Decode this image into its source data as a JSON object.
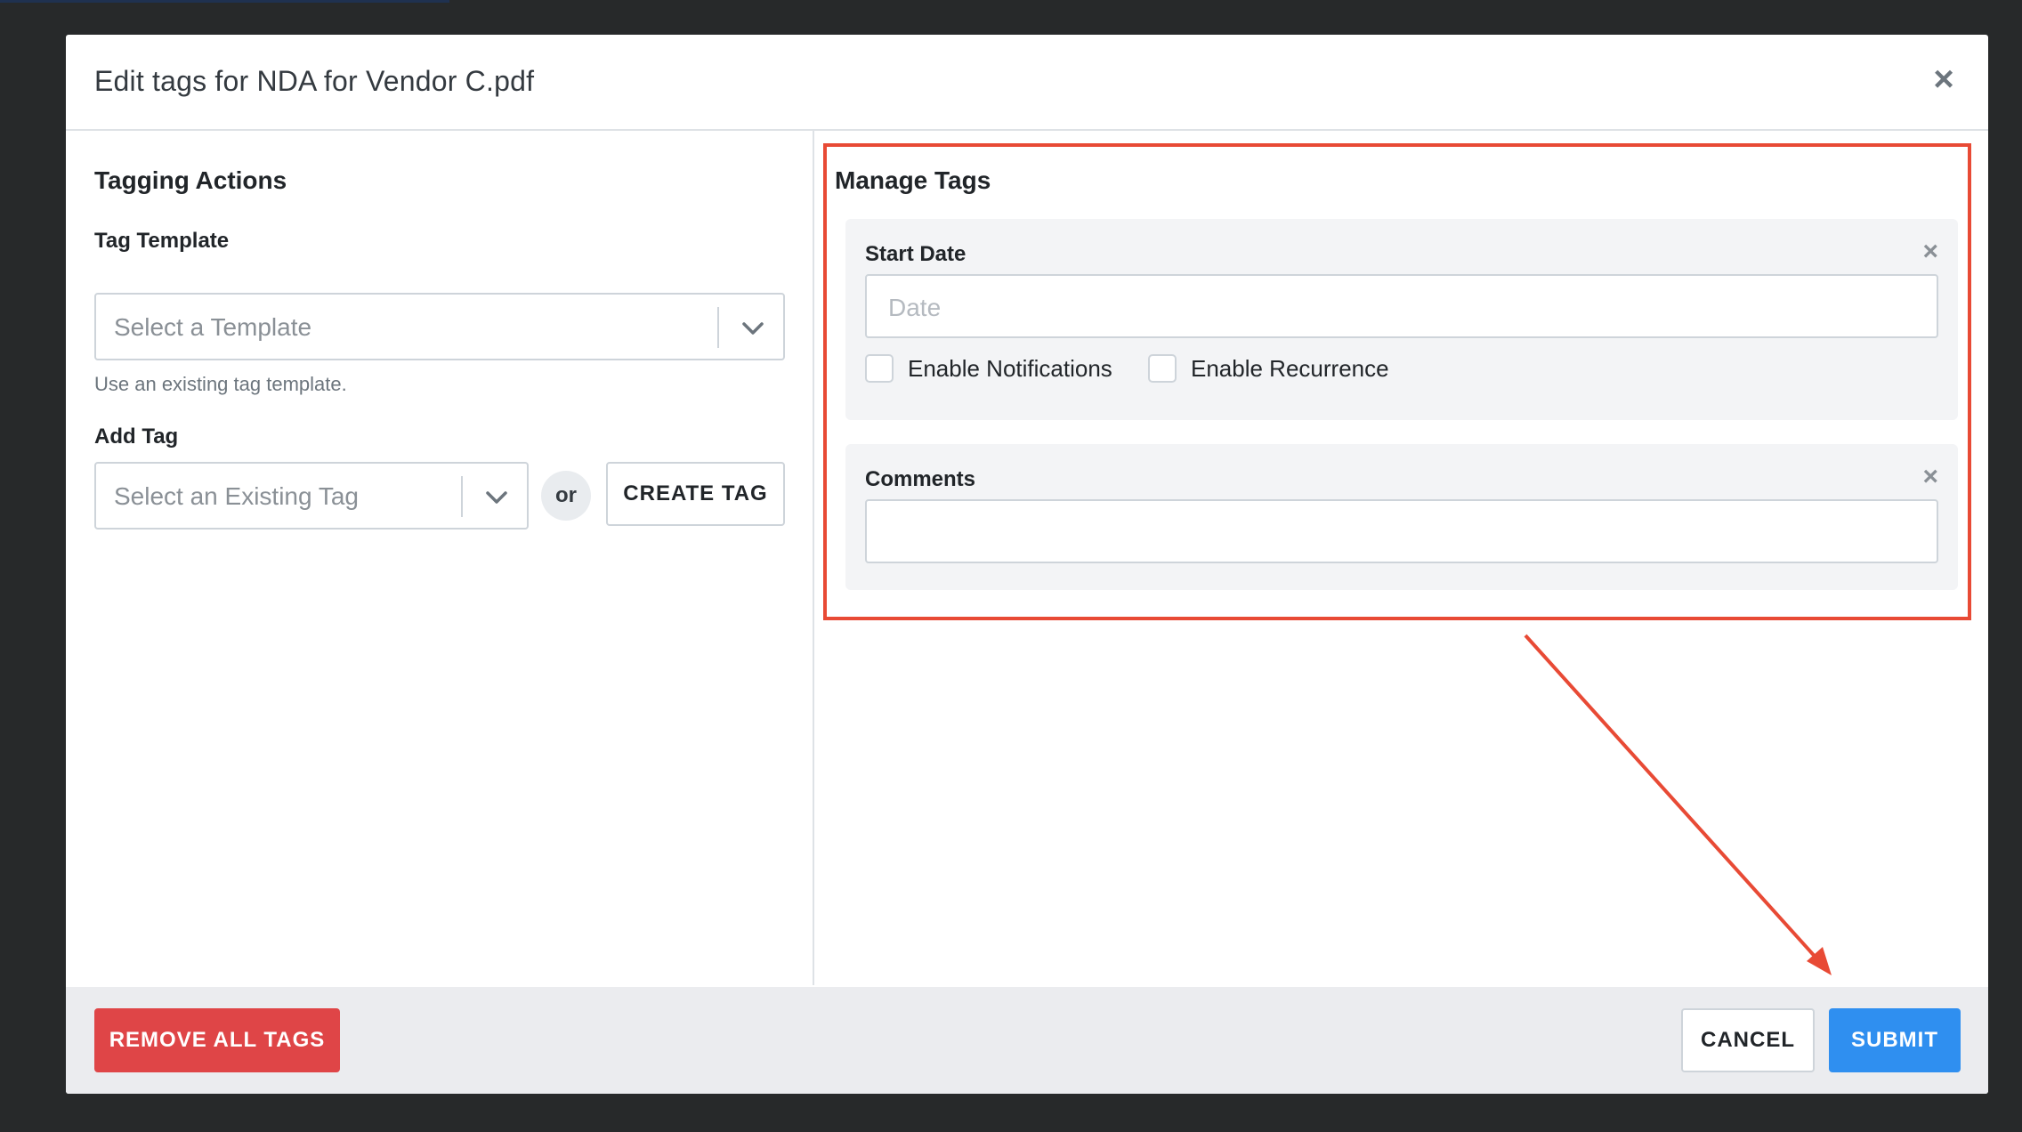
{
  "modal": {
    "title": "Edit tags for NDA for Vendor C.pdf",
    "close_icon": "close-icon"
  },
  "left": {
    "section_title": "Tagging Actions",
    "tag_template_label": "Tag Template",
    "tag_template_placeholder": "Select a Template",
    "tag_template_help": "Use an existing tag template.",
    "add_tag_label": "Add Tag",
    "add_tag_placeholder": "Select an Existing Tag",
    "or_text": "or",
    "create_tag_label": "CREATE TAG"
  },
  "right": {
    "section_title": "Manage Tags",
    "start_date": {
      "label": "Start Date",
      "placeholder": "Date",
      "enable_notifications": "Enable Notifications",
      "enable_recurrence": "Enable Recurrence"
    },
    "comments": {
      "label": "Comments",
      "value": ""
    }
  },
  "footer": {
    "remove_all_label": "REMOVE ALL TAGS",
    "cancel_label": "CANCEL",
    "submit_label": "SUBMIT"
  },
  "colors": {
    "highlight": "#e84a35",
    "danger": "#df4547",
    "primary": "#2f8ff0"
  }
}
